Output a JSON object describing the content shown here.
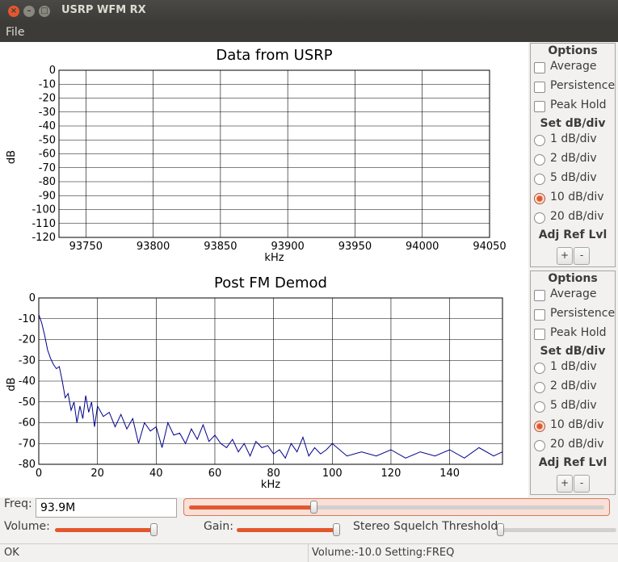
{
  "window": {
    "title": "USRP WFM RX"
  },
  "menu": {
    "file": "File"
  },
  "plots": [
    {
      "title": "Data from USRP",
      "xlabel": "kHz",
      "ylabel": "dB",
      "yticks": [
        "0",
        "-10",
        "-20",
        "-30",
        "-40",
        "-50",
        "-60",
        "-70",
        "-80",
        "-90",
        "-100",
        "-110",
        "-120"
      ],
      "xticks": [
        "93750",
        "93800",
        "93850",
        "93900",
        "93950",
        "94000",
        "94050"
      ]
    },
    {
      "title": "Post FM Demod",
      "xlabel": "kHz",
      "ylabel": "dB",
      "yticks": [
        "0",
        "-10",
        "-20",
        "-30",
        "-40",
        "-50",
        "-60",
        "-70",
        "-80"
      ],
      "xticks": [
        "0",
        "20",
        "40",
        "60",
        "80",
        "100",
        "120",
        "140"
      ]
    }
  ],
  "chart_data": [
    {
      "type": "line",
      "title": "Data from USRP",
      "xlabel": "kHz",
      "ylabel": "dB",
      "xlim": [
        93730,
        94050
      ],
      "ylim": [
        -120,
        0
      ],
      "grid": true,
      "series": []
    },
    {
      "type": "line",
      "title": "Post FM Demod",
      "xlabel": "kHz",
      "ylabel": "dB",
      "xlim": [
        0,
        158
      ],
      "ylim": [
        -80,
        0
      ],
      "grid": true,
      "series": [
        {
          "color": "#00008b",
          "x": [
            0,
            1,
            2,
            3,
            4,
            5,
            6,
            7,
            8,
            9,
            10,
            11,
            12,
            13,
            14,
            15,
            16,
            17,
            18,
            19,
            20,
            22,
            24,
            26,
            28,
            30,
            32,
            34,
            36,
            38,
            40,
            42,
            44,
            46,
            48,
            50,
            52,
            54,
            56,
            58,
            60,
            62,
            64,
            66,
            68,
            70,
            72,
            74,
            76,
            78,
            80,
            82,
            84,
            86,
            88,
            90,
            92,
            94,
            96,
            98,
            100,
            105,
            110,
            115,
            120,
            125,
            130,
            135,
            140,
            145,
            150,
            155,
            158
          ],
          "y": [
            -8,
            -12,
            -18,
            -25,
            -29,
            -32,
            -34,
            -33,
            -40,
            -48,
            -46,
            -54,
            -50,
            -60,
            -52,
            -58,
            -47,
            -55,
            -50,
            -62,
            -52,
            -57,
            -55,
            -62,
            -56,
            -63,
            -58,
            -70,
            -60,
            -64,
            -62,
            -72,
            -60,
            -66,
            -65,
            -70,
            -63,
            -68,
            -61,
            -69,
            -66,
            -70,
            -72,
            -68,
            -74,
            -70,
            -76,
            -69,
            -72,
            -71,
            -75,
            -73,
            -77,
            -70,
            -74,
            -67,
            -76,
            -72,
            -75,
            -73,
            -70,
            -76,
            -74,
            -76,
            -73,
            -77,
            -74,
            -76,
            -73,
            -77,
            -72,
            -76,
            -74
          ]
        }
      ]
    }
  ],
  "options": [
    {
      "title": "Options",
      "average": "Average",
      "persistence": "Persistence",
      "peak_hold": "Peak Hold",
      "set_db_div": "Set dB/div",
      "db_options": [
        "1 dB/div",
        "2 dB/div",
        "5 dB/div",
        "10 dB/div",
        "20 dB/div"
      ],
      "selected_db": "10 dB/div",
      "adj_ref": "Adj Ref Lvl",
      "plus": "+",
      "minus": "-"
    },
    {
      "title": "Options",
      "average": "Average",
      "persistence": "Persistence",
      "peak_hold": "Peak Hold",
      "set_db_div": "Set dB/div",
      "db_options": [
        "1 dB/div",
        "2 dB/div",
        "5 dB/div",
        "10 dB/div",
        "20 dB/div"
      ],
      "selected_db": "10 dB/div",
      "adj_ref": "Adj Ref Lvl",
      "plus": "+",
      "minus": "-"
    }
  ],
  "controls": {
    "freq_label": "Freq:",
    "freq_value": "93.9M",
    "freq_slider_fraction": 0.3,
    "volume_label": "Volume:",
    "volume_fraction": 0.97,
    "gain_label": "Gain:",
    "gain_fraction": 0.98,
    "squelch_label": "Stereo Squelch Threshold:",
    "squelch_fraction": 0.0
  },
  "status": {
    "left": "OK",
    "right": "Volume:-10.0  Setting:FREQ"
  },
  "colors": {
    "accent": "#e2572e",
    "trace": "#00008b"
  }
}
